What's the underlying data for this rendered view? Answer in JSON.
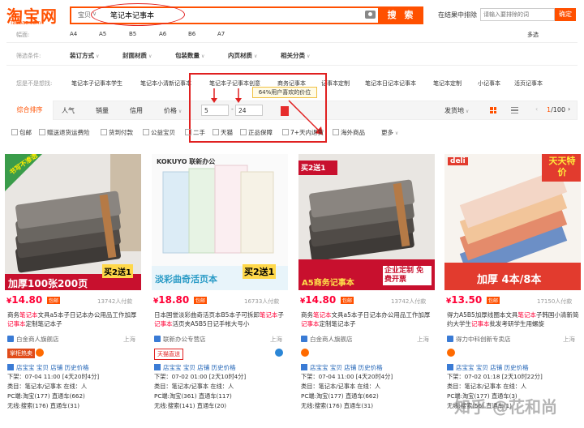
{
  "header": {
    "logo_cn": "淘宝网",
    "logo_en": "Taobao.com",
    "search_scope": "宝贝",
    "search_query": "笔记本记事本",
    "search_button": "搜 索",
    "in_result_label": "在结果中排除",
    "in_result_placeholder": "请输入要排除的词",
    "confirm_label": "确定"
  },
  "filters": {
    "size_label": "幅面:",
    "sizes": [
      "A4",
      "A5",
      "B5",
      "A6",
      "B6",
      "A7"
    ],
    "multi_label": "多选",
    "criteria_label": "筛选条件:",
    "criteria": [
      "装订方式",
      "封面材质",
      "包装数量",
      "内页材质",
      "相关分类"
    ],
    "suggest_label": "您是不是想找:",
    "suggestions": [
      "笔记本子记事本学生",
      "笔记本小清新记事本",
      "笔记本子记事本创意",
      "商务记事本",
      "记事本定制",
      "笔记本日记本记事本",
      "笔记本定制",
      "小记事本",
      "活页记事本"
    ]
  },
  "sortbar": {
    "tabs": [
      "综合排序",
      "人气",
      "销量",
      "信用",
      "价格"
    ],
    "price_min": "5",
    "price_max": "24",
    "price_tip": "64%用户喜欢的价位",
    "ship_from": "发货地",
    "page_current": "1",
    "page_total": "/100"
  },
  "checkboxes": [
    "包邮",
    "赠送退货运费险",
    "货到付款",
    "公益宝贝",
    "二手",
    "天猫",
    "正品保障",
    "7+天内退货",
    "海外商品",
    "更多"
  ],
  "cards": [
    {
      "price": "14.80",
      "post": "包邮",
      "sold": "13742人付款",
      "title_pre": "商务",
      "title_hl1": "笔记本",
      "title_mid": "文具a5本子日记本办公用品工作加厚",
      "title_hl2": "记事本",
      "title_post": "定制笔记本子",
      "shop": "白金商人旗舰店",
      "loc": "上海",
      "badge": "掌柜热卖",
      "ext_links": "店宝宝 宝贝 店铺 历史价格",
      "ext_1": "下架：07-04 11:00 [4天20时4分]",
      "ext_2": "类目：笔记本/记事本 在线：人",
      "ext_3": "PC端:淘宝(177) 直通车(662)",
      "ext_4": "无线:搜索(176) 直通车(31)",
      "img_big": "加厚100张200页",
      "img_tag1": "书写不渗透",
      "img_tag2": "买2送1"
    },
    {
      "price": "18.80",
      "post": "包邮",
      "sold": "16733人付款",
      "title_pre": "日本国誉淡彩曲奇活页本B5本子可拆卸",
      "title_hl1": "笔记本",
      "title_mid": "子",
      "title_hl2": "记事本",
      "title_post": "活页夹A5B5日记手帐大号小",
      "shop": "联新办公专营店",
      "loc": "上海",
      "badge": "天猫直送",
      "ext_links": "店宝宝 宝贝 店铺 历史价格",
      "ext_1": "下架：07-02 01:00 [2天10时4分]",
      "ext_2": "类目：笔记本/记事本 在线：人",
      "ext_3": "PC端:淘宝(361) 直通车(117)",
      "ext_4": "无线:搜索(141) 直通车(20)",
      "img_big": "淡彩曲奇活页本",
      "img_tag1": "KOKUYO 联新办公",
      "img_tag2": "买2送1"
    },
    {
      "price": "14.80",
      "post": "包邮",
      "sold": "13742人付款",
      "title_pre": "商务",
      "title_hl1": "笔记本",
      "title_mid": "文具a5本子日记本办公用品工作加厚",
      "title_hl2": "记事本",
      "title_post": "定制笔记本子",
      "shop": "白金商人旗舰店",
      "loc": "上海",
      "badge": "",
      "ext_links": "店宝宝 宝贝 店铺 历史价格",
      "ext_1": "下架：07-04 11:00 [4天20时4分]",
      "ext_2": "类目：笔记本/记事本 在线：人",
      "ext_3": "PC端:淘宝(177) 直通车(662)",
      "ext_4": "无线:搜索(176) 直通车(31)",
      "img_big": "A5商务记事本",
      "img_tag1": "买2送1",
      "img_tag2": "企业定制 免费开票"
    },
    {
      "price": "13.50",
      "post": "包邮",
      "sold": "17150人付款",
      "title_pre": "得力A5B5加厚线圈本文具",
      "title_hl1": "笔记本",
      "title_mid": "子韩国小清新简约大学生",
      "title_hl2": "记事本",
      "title_post": "批发考研学生用螺旋",
      "shop": "得力中科创新专卖店",
      "loc": "上海",
      "badge": "",
      "ext_links": "店宝宝 宝贝 店铺 历史价格",
      "ext_1": "下架：07-02 01:18 [2天10时22分]",
      "ext_2": "类目：笔记本/记事本 在线：人",
      "ext_3": "PC端:淘宝(177) 直通车(3)",
      "ext_4": "无线:搜索(56) 直通车(1)",
      "img_big": "加厚 4本/8本",
      "img_tag1": "deli",
      "img_tag2": "天天特价"
    }
  ],
  "watermark": "知乎 @花和尚"
}
